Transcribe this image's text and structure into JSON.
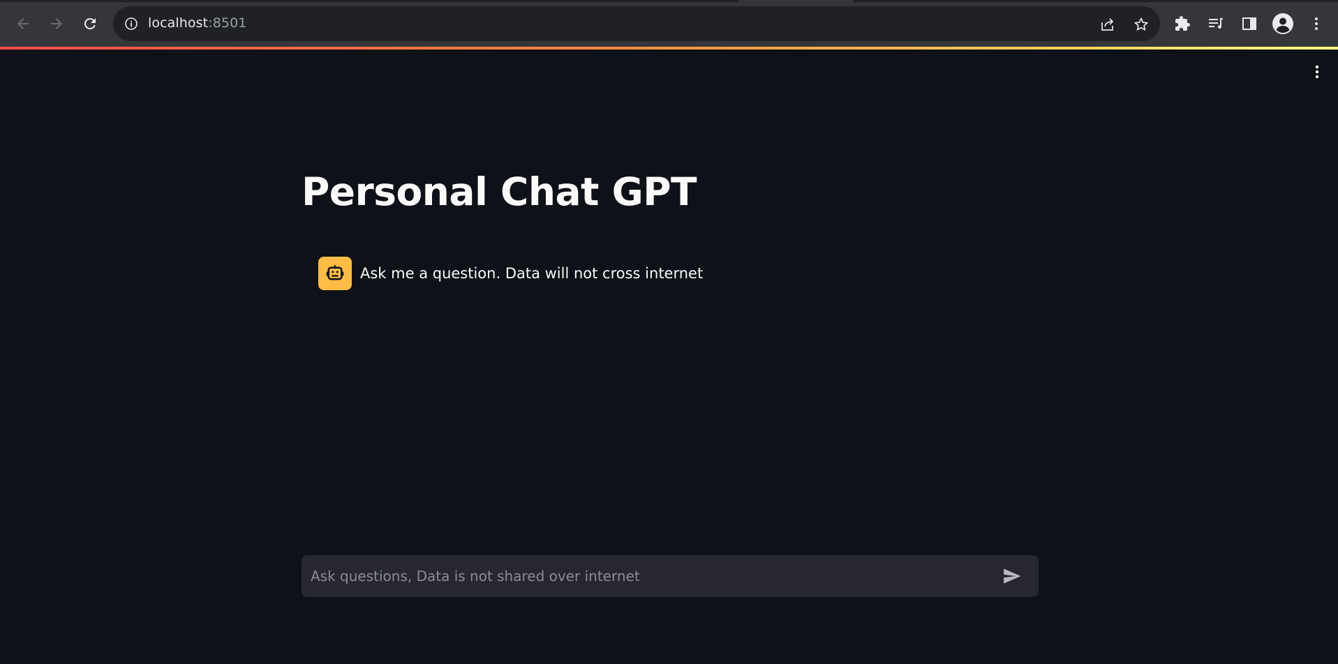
{
  "browser": {
    "url_host": "localhost",
    "url_port": ":8501",
    "icons": {
      "back": "arrow-left-icon",
      "forward": "arrow-right-icon",
      "reload": "reload-icon",
      "site_info": "info-icon",
      "share": "share-icon",
      "bookmark": "star-icon",
      "extensions": "puzzle-icon",
      "media": "media-queue-icon",
      "side_panel": "side-panel-icon",
      "profile": "account-icon",
      "menu": "kebab-menu-icon"
    }
  },
  "app": {
    "title": "Personal Chat GPT",
    "messages": [
      {
        "role": "assistant",
        "avatar_icon": "robot-icon",
        "text": "Ask me a question. Data will not cross internet"
      }
    ],
    "chat_input": {
      "placeholder": "Ask questions, Data is not shared over internet",
      "value": ""
    },
    "colors": {
      "background": "#0e1117",
      "avatar": "#ffbd45",
      "input_background": "#262730",
      "text": "#fafafa"
    }
  }
}
